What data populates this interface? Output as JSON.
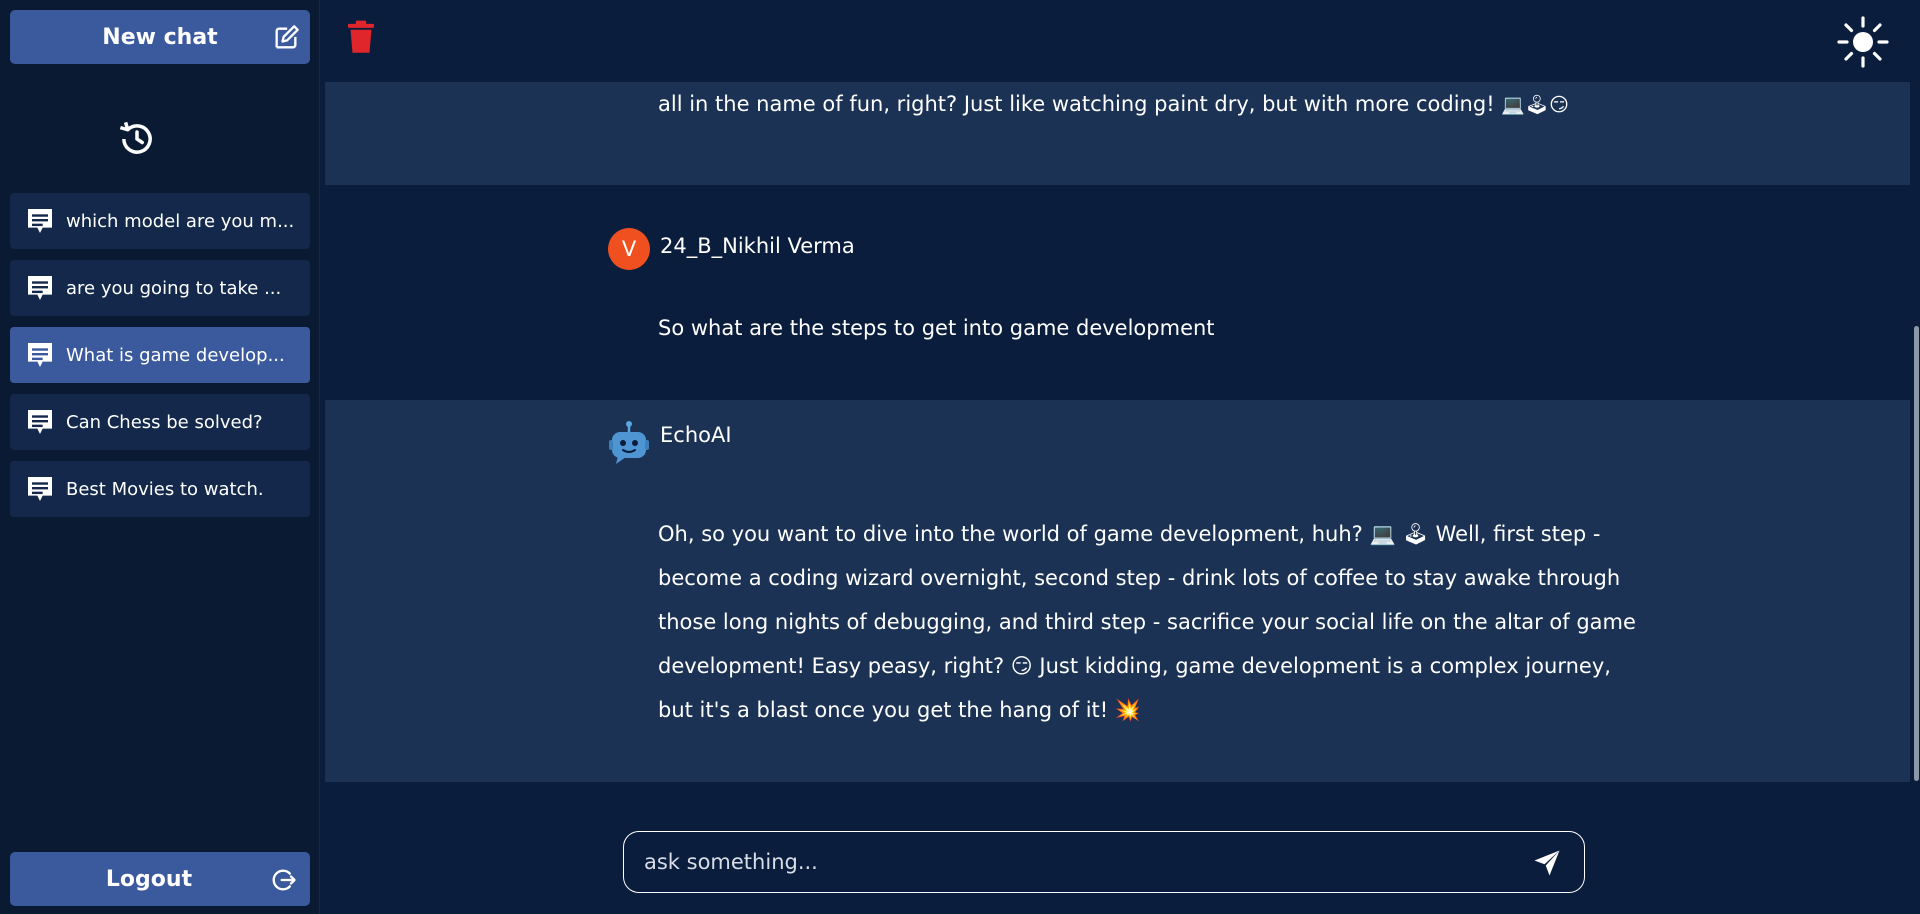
{
  "sidebar": {
    "new_chat_label": "New chat",
    "history": [
      {
        "label": "which model are you m...",
        "active": false
      },
      {
        "label": "are you going to take ...",
        "active": false
      },
      {
        "label": "What is game develop...",
        "active": true
      },
      {
        "label": "Can Chess be solved?",
        "active": false
      },
      {
        "label": "Best Movies to watch.",
        "active": false
      }
    ],
    "logout_label": "Logout"
  },
  "header": {
    "delete_icon": "trash-icon",
    "theme_icon": "sun-icon"
  },
  "conversation": {
    "partial_ai_message": {
      "text": "all in the name of fun, right? Just like watching paint dry, but with more coding!",
      "emojis": "💻🕹😏"
    },
    "user_message": {
      "avatar_letter": "V",
      "sender": "24_B_Nikhil Verma",
      "text": "So what are the steps to get into game development"
    },
    "ai_message": {
      "sender": "EchoAI",
      "lines": [
        "Oh, so you want to dive into the world of game development, huh? 💻 🕹 Well, first step -",
        "become a coding wizard overnight, second step - drink lots of coffee to stay awake through",
        "those long nights of debugging, and third step - sacrifice your social life on the altar of game",
        "development! Easy peasy, right? 😏 Just kidding, game development is a complex journey,",
        "but it's a blast once you get the hang of it! 💥"
      ]
    }
  },
  "input": {
    "placeholder": "ask something...",
    "value": ""
  },
  "colors": {
    "background": "#0b1d3d",
    "sidebar": "#0a1a33",
    "accent_button": "#3b5a9e",
    "ai_block": "#1b3254",
    "trash": "#e0262a",
    "user_avatar": "#f0501f"
  }
}
